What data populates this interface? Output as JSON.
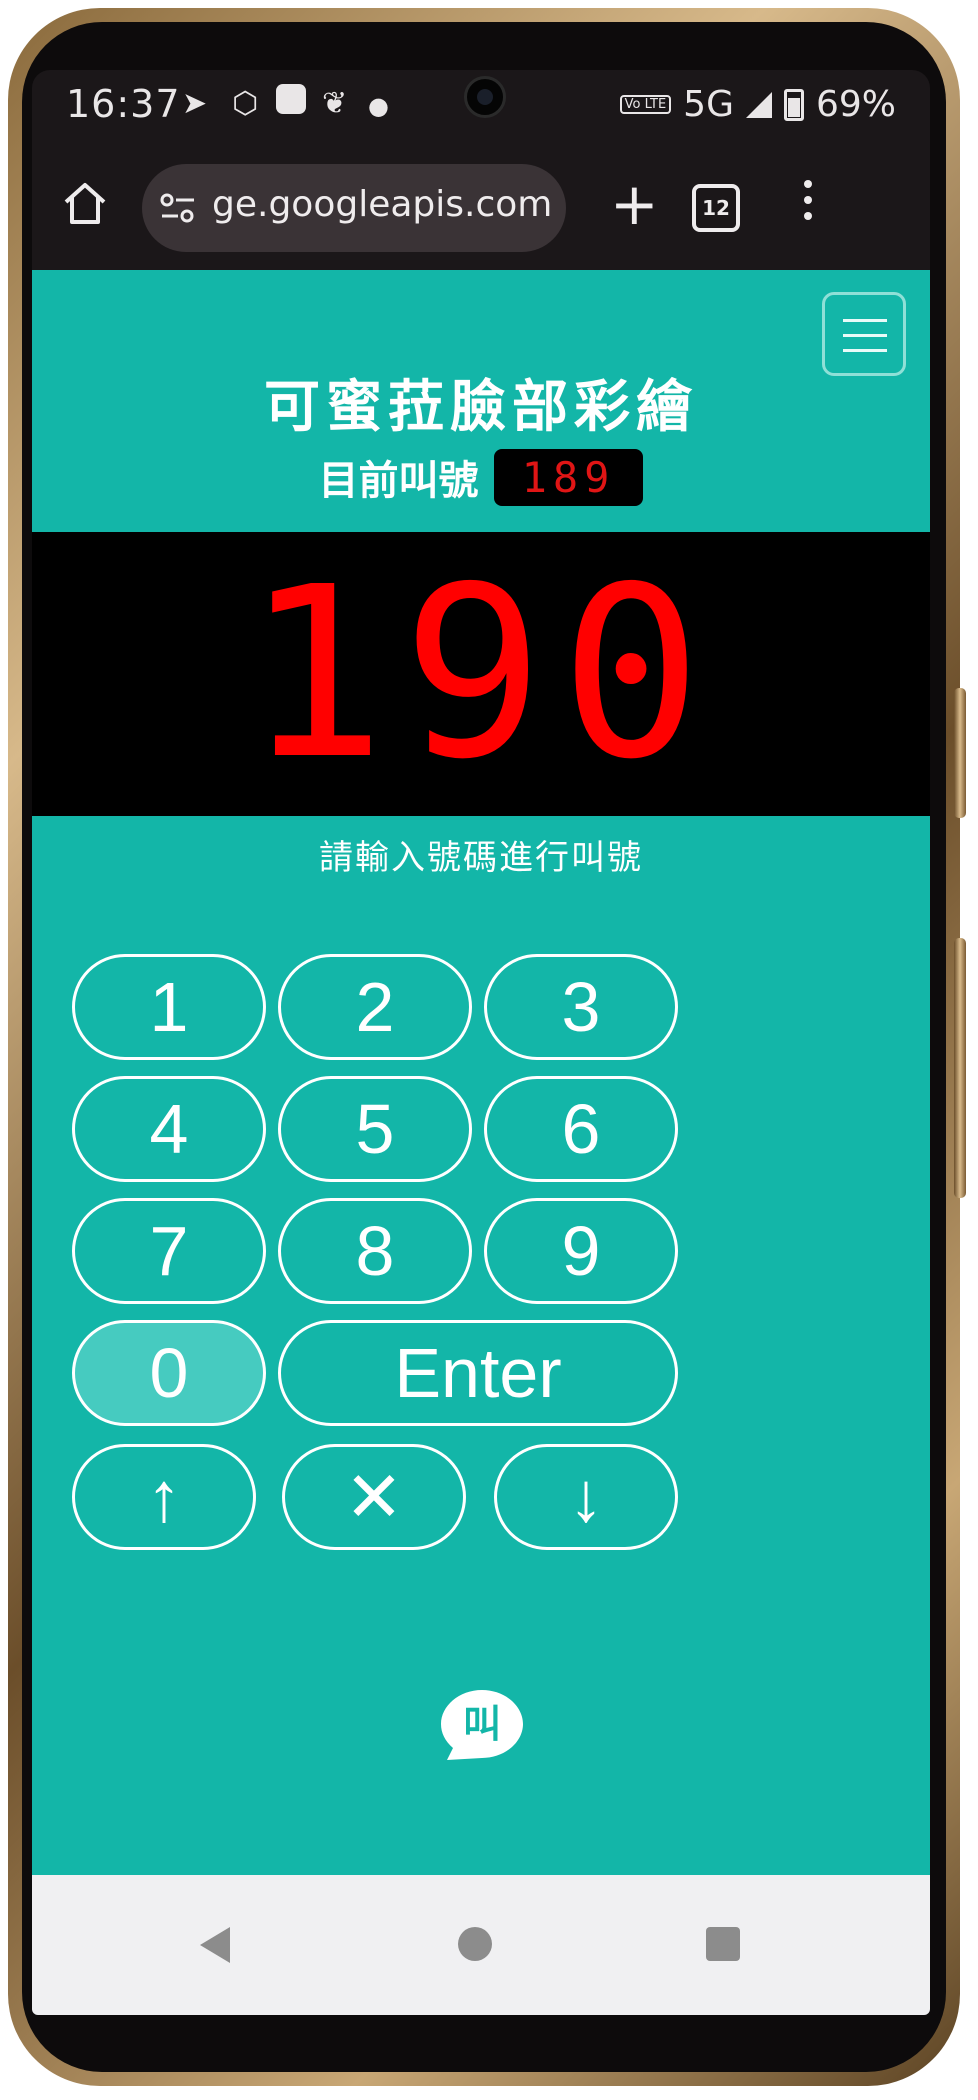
{
  "status_bar": {
    "time": "16:37",
    "network": "5G",
    "battery": "69%",
    "volte": "Vo LTE",
    "icons": [
      "telegram-icon",
      "hexagon-icon",
      "app-icon",
      "leaf-icon",
      "dot-icon"
    ]
  },
  "browser": {
    "url": "ge.googleapis.com",
    "tab_count": "12"
  },
  "app": {
    "title": "可蜜菈臉部彩繪",
    "current_label": "目前叫號",
    "current_number": "189",
    "display_number": "190",
    "hint": "請輸入號碼進行叫號",
    "keys": [
      "1",
      "2",
      "3",
      "4",
      "5",
      "6",
      "7",
      "8",
      "9",
      "0"
    ],
    "enter_label": "Enter",
    "up_label": "↑",
    "clear_label": "✕",
    "down_label": "↓",
    "logo_text": "叫"
  },
  "colors": {
    "primary": "#13b6a8",
    "display_bg": "#000000",
    "display_text": "#ff0000",
    "key_active": "#46cbc0"
  }
}
